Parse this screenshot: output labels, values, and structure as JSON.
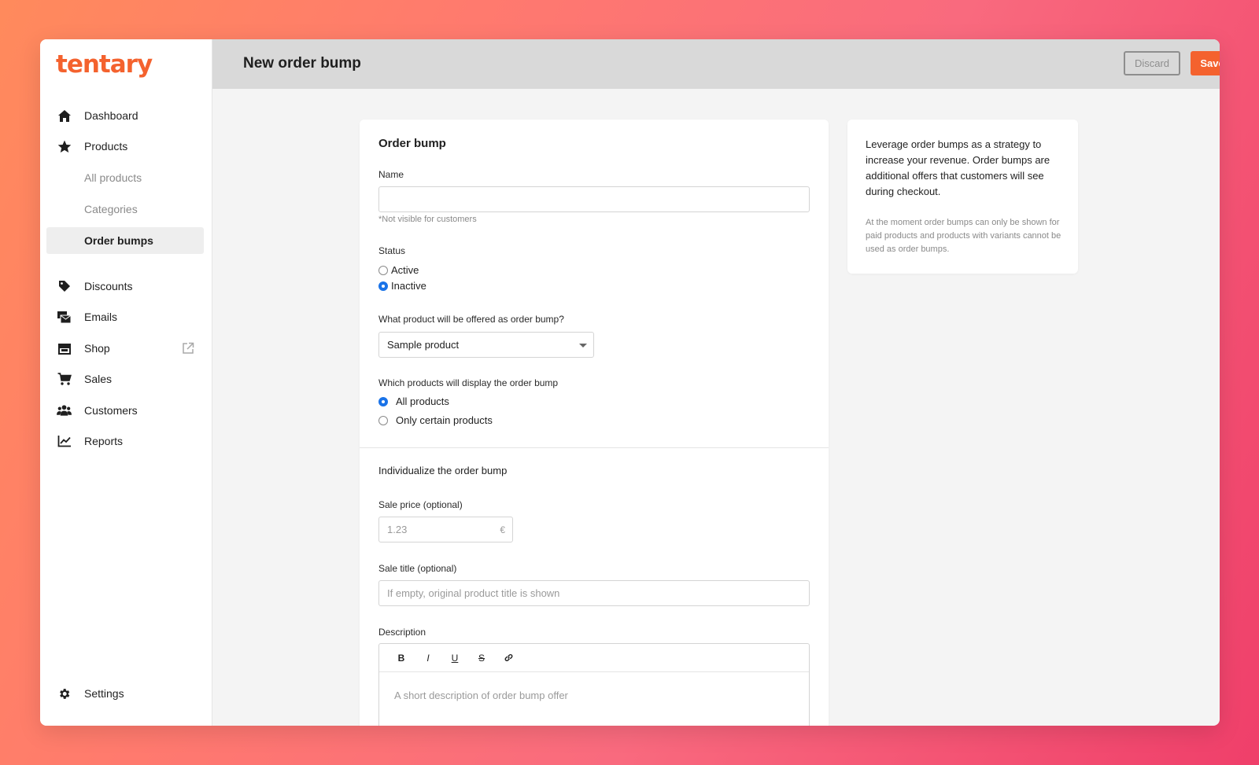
{
  "app": {
    "logo": "tentary",
    "brand_color": "#f4622e"
  },
  "sidebar": {
    "items": [
      {
        "label": "Dashboard",
        "icon": "home-icon"
      },
      {
        "label": "Products",
        "icon": "star-icon"
      },
      {
        "label": "All products"
      },
      {
        "label": "Categories"
      },
      {
        "label": "Order bumps",
        "active": true
      },
      {
        "label": "Discounts",
        "icon": "tag-icon"
      },
      {
        "label": "Emails",
        "icon": "mail-icon"
      },
      {
        "label": "Shop",
        "icon": "store-icon"
      },
      {
        "label": "Sales",
        "icon": "cart-icon"
      },
      {
        "label": "Customers",
        "icon": "users-icon"
      },
      {
        "label": "Reports",
        "icon": "chart-icon"
      },
      {
        "label": "Settings",
        "icon": "gear-icon"
      }
    ]
  },
  "header": {
    "title": "New order bump",
    "discard_label": "Discard",
    "save_label": "Save"
  },
  "form": {
    "section_title": "Order bump",
    "name_label": "Name",
    "name_value": "",
    "name_hint": "*Not visible for customers",
    "status_label": "Status",
    "status_options": [
      "Active",
      "Inactive"
    ],
    "status_selected": "Inactive",
    "product_label": "What product will be offered as order bump?",
    "product_value": "Sample product",
    "display_label": "Which products will display the order bump",
    "display_options": [
      "All products",
      "Only certain products"
    ],
    "display_selected": "All products",
    "individualize_title": "Individualize the order bump",
    "sale_price_label": "Sale price (optional)",
    "sale_price_placeholder": "1.23",
    "currency": "€",
    "sale_title_label": "Sale title (optional)",
    "sale_title_placeholder": "If empty, original product title is shown",
    "description_label": "Description",
    "description_placeholder": "A short description of order bump offer",
    "toolbar": [
      "B",
      "I",
      "U",
      "S",
      "link-icon"
    ]
  },
  "info": {
    "text": "Leverage order bumps as a strategy to increase your revenue. Order bumps are additional offers that customers will see during checkout.",
    "note": "At the moment order bumps can only be shown for paid products and products with variants cannot be used as order bumps."
  }
}
